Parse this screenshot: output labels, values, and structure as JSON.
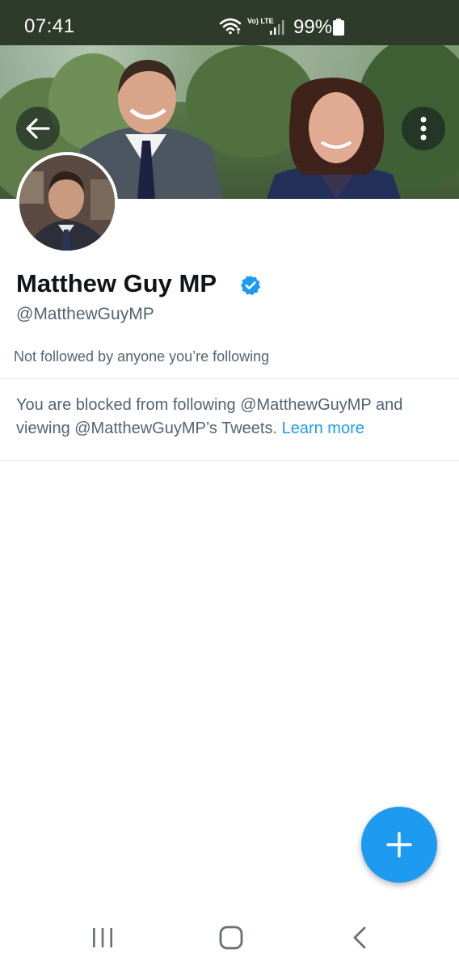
{
  "status_bar": {
    "time": "07:41",
    "network_label": "Vo) LTE",
    "battery": "99%"
  },
  "header": {
    "back_icon": "arrow-left-icon",
    "more_icon": "more-vertical-icon"
  },
  "profile": {
    "display_name": "Matthew Guy MP",
    "handle": "@MatthewGuyMP",
    "verified_icon": "verified-badge-icon",
    "followed_by": "Not followed by anyone you’re following"
  },
  "blocked_notice": {
    "text": "You are blocked from following @MatthewGuyMP and viewing @MatthewGuyMP’s Tweets. ",
    "link": "Learn more"
  },
  "fab": {
    "icon": "plus-icon"
  },
  "nav": {
    "recents_icon": "recents-icon",
    "home_icon": "home-icon",
    "back_icon": "back-chevron-icon"
  },
  "colors": {
    "accent": "#1d9bf0",
    "status_bar_bg": "#2e3a2a",
    "secondary_text": "#536471"
  }
}
